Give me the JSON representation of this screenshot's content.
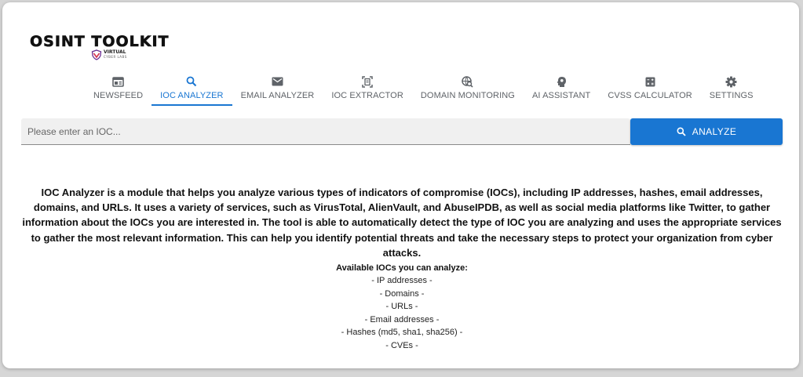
{
  "logo": {
    "title": "OSINT TOOLKIT",
    "sub_line1": "VIRTUAL",
    "sub_line2": "CYBER LABS"
  },
  "tabs": [
    {
      "label": "NEWSFEED",
      "icon": "newspaper-icon",
      "active": false
    },
    {
      "label": "IOC ANALYZER",
      "icon": "search-icon",
      "active": true
    },
    {
      "label": "EMAIL ANALYZER",
      "icon": "mail-icon",
      "active": false
    },
    {
      "label": "IOC EXTRACTOR",
      "icon": "document-scan-icon",
      "active": false
    },
    {
      "label": "DOMAIN MONITORING",
      "icon": "globe-search-icon",
      "active": false
    },
    {
      "label": "AI ASSISTANT",
      "icon": "brain-head-icon",
      "active": false
    },
    {
      "label": "CVSS CALCULATOR",
      "icon": "calculator-icon",
      "active": false
    },
    {
      "label": "SETTINGS",
      "icon": "gear-icon",
      "active": false
    }
  ],
  "search": {
    "placeholder": "Please enter an IOC...",
    "value": "",
    "button_label": "ANALYZE"
  },
  "description": "IOC Analyzer is a module that helps you analyze various types of indicators of compromise (IOCs), including IP addresses, hashes, email addresses, domains, and URLs. It uses a variety of services, such as VirusTotal, AlienVault, and AbuseIPDB, as well as social media platforms like Twitter, to gather information about the IOCs you are interested in. The tool is able to automatically detect the type of IOC you are analyzing and uses the appropriate services to gather the most relevant information. This can help you identify potential threats and take the necessary steps to protect your organization from cyber attacks.",
  "available": {
    "title": "Available IOCs you can analyze:",
    "items": [
      "- IP addresses -",
      "- Domains -",
      "- URLs -",
      "- Email addresses -",
      "- Hashes (md5, sha1, sha256) -",
      "- CVEs -"
    ]
  },
  "colors": {
    "accent": "#1976d2",
    "tab_text": "#5f6368",
    "background": "#ffffff"
  }
}
